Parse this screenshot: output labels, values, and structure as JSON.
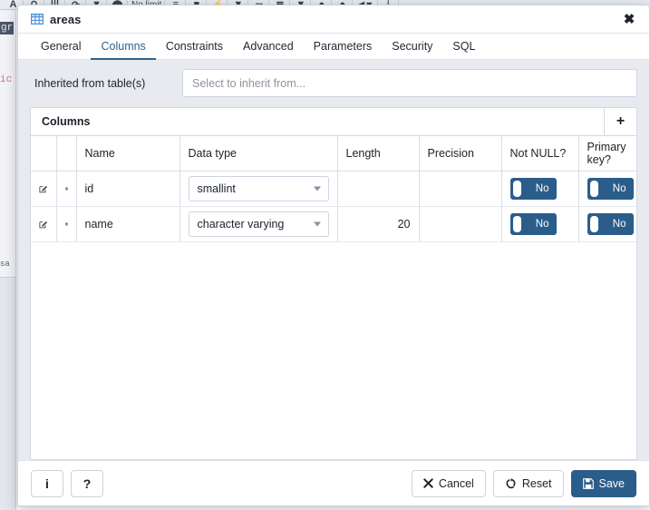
{
  "background": {
    "toolbar_items": [
      "A",
      "Q",
      "III",
      "↺",
      "▼",
      "⬤",
      "No limit",
      "≡",
      "■",
      "⚡",
      "▼",
      "⤳",
      "≣",
      "▼",
      "●",
      "●",
      "◀▼",
      "⤓"
    ],
    "no_limit_label": "No limit",
    "fragments": {
      "gr": "gr",
      "ic": "ic",
      "sa": "sa"
    }
  },
  "dialog": {
    "title": "areas",
    "title_icon": "table-icon",
    "close_icon": "close-icon",
    "tabs": [
      {
        "label": "General",
        "active": false
      },
      {
        "label": "Columns",
        "active": true
      },
      {
        "label": "Constraints",
        "active": false
      },
      {
        "label": "Advanced",
        "active": false
      },
      {
        "label": "Parameters",
        "active": false
      },
      {
        "label": "Security",
        "active": false
      },
      {
        "label": "SQL",
        "active": false
      }
    ],
    "inherited": {
      "label": "Inherited from table(s)",
      "placeholder": "Select to inherit from...",
      "value": ""
    },
    "columns_panel": {
      "title": "Columns",
      "add_icon": "plus-icon",
      "headers": [
        "",
        "",
        "Name",
        "Data type",
        "Length",
        "Precision",
        "Not NULL?",
        "Primary key?"
      ],
      "rows": [
        {
          "edit_icon": "edit-icon",
          "delete_icon": "trash-icon",
          "name": "id",
          "data_type": "smallint",
          "length": "",
          "length_disabled": true,
          "precision": "",
          "precision_disabled": true,
          "not_null": "No",
          "primary_key": "No"
        },
        {
          "edit_icon": "edit-icon",
          "delete_icon": "trash-icon",
          "name": "name",
          "data_type": "character varying",
          "length": "20",
          "length_disabled": false,
          "precision": "",
          "precision_disabled": true,
          "not_null": "No",
          "primary_key": "No"
        }
      ]
    },
    "footer": {
      "info_label": "i",
      "help_label": "?",
      "cancel_label": "Cancel",
      "cancel_icon": "x-icon",
      "reset_label": "Reset",
      "reset_icon": "refresh-icon",
      "save_label": "Save",
      "save_icon": "save-icon"
    }
  },
  "colors": {
    "accent": "#2b5d8b",
    "tab_active": "#2b6393",
    "body_bg": "#e8eaf0",
    "toggle_on": "#2b5d8b"
  }
}
